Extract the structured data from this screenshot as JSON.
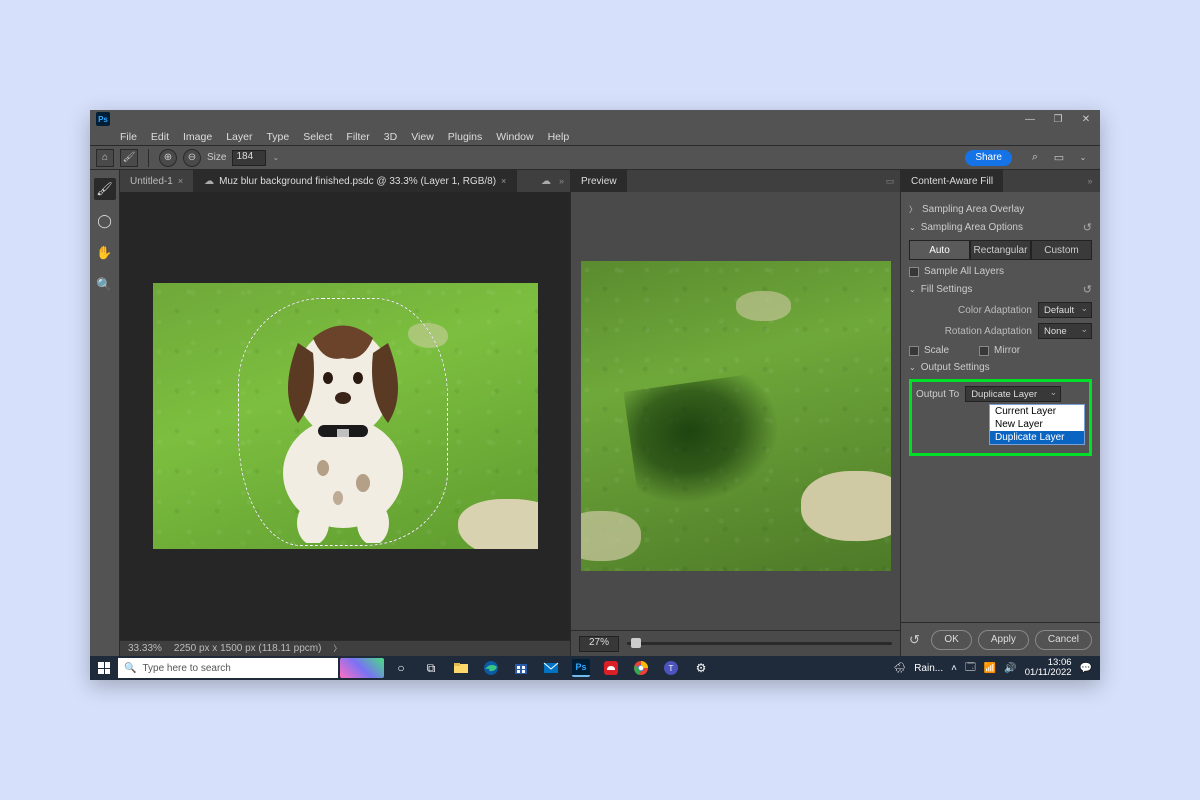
{
  "menubar": [
    "File",
    "Edit",
    "Image",
    "Layer",
    "Type",
    "Select",
    "Filter",
    "3D",
    "View",
    "Plugins",
    "Window",
    "Help"
  ],
  "optionsbar": {
    "size_label": "Size",
    "size_value": "184",
    "share": "Share"
  },
  "tabs": {
    "tab1": "Untitled-1",
    "tab2": "Muz blur background finished.psdc @ 33.3% (Layer 1, RGB/8)"
  },
  "status": {
    "zoom": "33.33%",
    "dims": "2250 px x 1500 px (118.11 ppcm)"
  },
  "preview": {
    "tab": "Preview",
    "zoom": "27%"
  },
  "caf": {
    "title": "Content-Aware Fill",
    "sampling_overlay": "Sampling Area Overlay",
    "sampling_options": "Sampling Area Options",
    "seg_auto": "Auto",
    "seg_rect": "Rectangular",
    "seg_custom": "Custom",
    "sample_all": "Sample All Layers",
    "fill_settings": "Fill Settings",
    "color_adapt": "Color Adaptation",
    "color_adapt_val": "Default",
    "rot_adapt": "Rotation Adaptation",
    "rot_adapt_val": "None",
    "scale": "Scale",
    "mirror": "Mirror",
    "output_settings": "Output Settings",
    "output_to": "Output To",
    "output_to_val": "Duplicate Layer",
    "dd_opt1": "Current Layer",
    "dd_opt2": "New Layer",
    "dd_opt3": "Duplicate Layer",
    "ok": "OK",
    "apply": "Apply",
    "cancel": "Cancel"
  },
  "taskbar": {
    "search_placeholder": "Type here to search",
    "weather": "Rain...",
    "time": "13:06",
    "date": "01/11/2022"
  }
}
